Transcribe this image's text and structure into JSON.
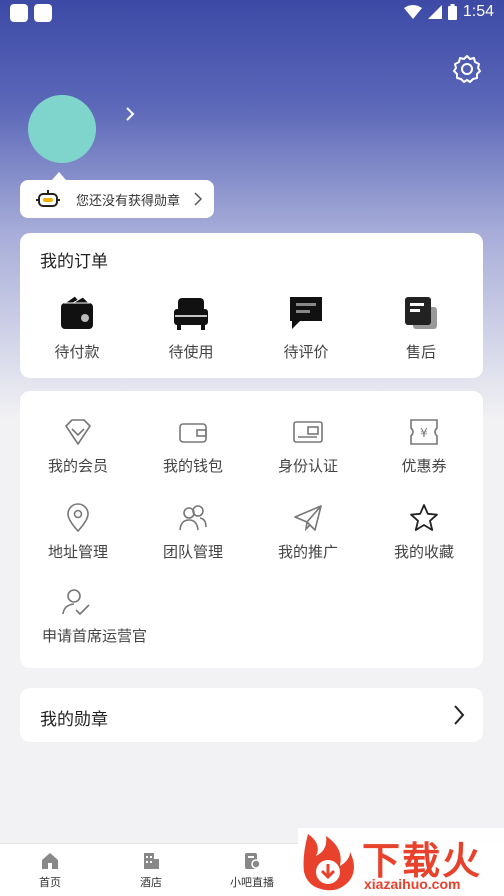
{
  "status_bar": {
    "time": "1:54"
  },
  "badge_tip": {
    "text": "您还没有获得勋章"
  },
  "orders": {
    "title": "我的订单",
    "items": [
      {
        "label": "待付款",
        "icon": "wallet-icon"
      },
      {
        "label": "待使用",
        "icon": "sofa-icon"
      },
      {
        "label": "待评价",
        "icon": "comment-icon"
      },
      {
        "label": "售后",
        "icon": "document-icon"
      }
    ]
  },
  "services": {
    "items": [
      {
        "label": "我的会员",
        "icon": "diamond-icon"
      },
      {
        "label": "我的钱包",
        "icon": "wallet-outline-icon"
      },
      {
        "label": "身份认证",
        "icon": "id-card-icon"
      },
      {
        "label": "优惠券",
        "icon": "coupon-icon"
      },
      {
        "label": "地址管理",
        "icon": "location-pin-icon"
      },
      {
        "label": "团队管理",
        "icon": "team-icon"
      },
      {
        "label": "我的推广",
        "icon": "paper-plane-icon"
      },
      {
        "label": "我的收藏",
        "icon": "star-icon"
      },
      {
        "label": "申请首席运营官",
        "icon": "user-apply-icon"
      }
    ]
  },
  "medals": {
    "title": "我的勋章"
  },
  "tabbar": {
    "tabs": [
      {
        "label": "首页",
        "icon": "home-icon"
      },
      {
        "label": "酒店",
        "icon": "hotel-icon"
      },
      {
        "label": "小吧直播",
        "icon": "live-icon"
      }
    ]
  },
  "watermark": {
    "text": "下载火",
    "url": "xiazaihuo.com"
  },
  "colors": {
    "accent": "#3d4aa6",
    "avatar": "#7fd5cb",
    "brand_red": "#e8412c"
  }
}
